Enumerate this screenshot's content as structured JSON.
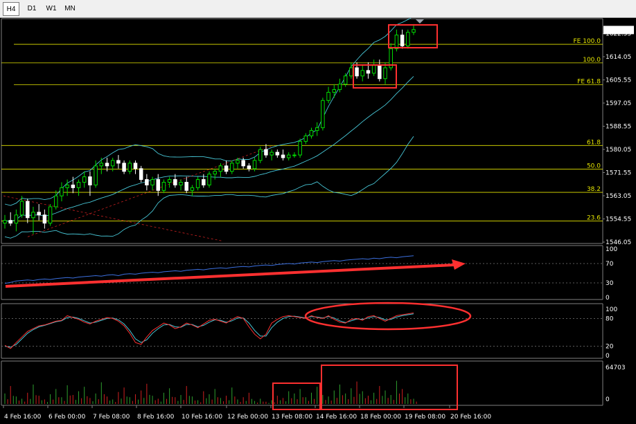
{
  "toolbar": {
    "timeframes": [
      {
        "label": "H4",
        "active": true
      },
      {
        "label": "D1",
        "active": false
      },
      {
        "label": "W1",
        "active": false
      },
      {
        "label": "MN",
        "active": false
      }
    ]
  },
  "chart_data": {
    "type": "candlestick",
    "main": {
      "ylim": [
        1546.05,
        1627.5
      ],
      "y_ticks": [
        1546.05,
        1554.55,
        1563.05,
        1571.55,
        1580.05,
        1588.55,
        1597.05,
        1605.55,
        1614.05,
        1622.55
      ],
      "current_price": 1623.85,
      "levels": [
        {
          "label": "FE 100.0",
          "price": 1618.6,
          "x_from": 20
        },
        {
          "label": "100.0",
          "price": 1611.8,
          "x_from": 0
        },
        {
          "label": "FE 61.8",
          "price": 1603.8,
          "x_from": 20
        },
        {
          "label": "61.8",
          "price": 1581.5,
          "x_from": 0
        },
        {
          "label": "50.0",
          "price": 1572.8,
          "x_from": 0
        },
        {
          "label": "38.2",
          "price": 1564.3,
          "x_from": 0
        },
        {
          "label": "23.6",
          "price": 1553.8,
          "x_from": 0
        }
      ],
      "ohlc": [
        [
          1553,
          1556,
          1551,
          1554
        ],
        [
          1554,
          1557,
          1552,
          1553
        ],
        [
          1553,
          1558,
          1550,
          1556
        ],
        [
          1556,
          1563,
          1555,
          1561
        ],
        [
          1561,
          1562,
          1553,
          1555
        ],
        [
          1555,
          1559,
          1549,
          1557
        ],
        [
          1557,
          1560,
          1554,
          1556
        ],
        [
          1556,
          1558,
          1551,
          1553
        ],
        [
          1553,
          1560,
          1552,
          1559
        ],
        [
          1559,
          1565,
          1558,
          1563
        ],
        [
          1563,
          1568,
          1561,
          1566
        ],
        [
          1566,
          1569,
          1563,
          1567
        ],
        [
          1567,
          1570,
          1564,
          1566
        ],
        [
          1566,
          1569,
          1563,
          1568
        ],
        [
          1568,
          1572,
          1566,
          1570
        ],
        [
          1570,
          1572,
          1563,
          1567
        ],
        [
          1567,
          1576,
          1566,
          1574
        ],
        [
          1574,
          1577,
          1571,
          1575
        ],
        [
          1575,
          1577,
          1572,
          1574
        ],
        [
          1574,
          1577,
          1572,
          1576
        ],
        [
          1576,
          1578,
          1573,
          1575
        ],
        [
          1575,
          1576,
          1571,
          1572
        ],
        [
          1572,
          1576,
          1571,
          1575
        ],
        [
          1575,
          1576,
          1571,
          1573
        ],
        [
          1573,
          1574,
          1568,
          1569
        ],
        [
          1569,
          1571,
          1565,
          1567
        ],
        [
          1567,
          1570,
          1565,
          1569
        ],
        [
          1569,
          1571,
          1563,
          1565
        ],
        [
          1565,
          1569,
          1564,
          1568
        ],
        [
          1568,
          1570,
          1566,
          1569
        ],
        [
          1569,
          1571,
          1566,
          1567
        ],
        [
          1567,
          1569,
          1565,
          1568
        ],
        [
          1568,
          1570,
          1564,
          1565
        ],
        [
          1565,
          1567,
          1563,
          1566
        ],
        [
          1566,
          1570,
          1565,
          1569
        ],
        [
          1569,
          1571,
          1566,
          1567
        ],
        [
          1567,
          1572,
          1566,
          1571
        ],
        [
          1571,
          1573,
          1569,
          1572
        ],
        [
          1572,
          1575,
          1570,
          1574
        ],
        [
          1574,
          1576,
          1571,
          1572
        ],
        [
          1572,
          1576,
          1571,
          1575
        ],
        [
          1575,
          1577,
          1573,
          1576
        ],
        [
          1576,
          1577,
          1573,
          1574
        ],
        [
          1574,
          1575,
          1572,
          1573
        ],
        [
          1573,
          1577,
          1572,
          1576
        ],
        [
          1576,
          1581,
          1575,
          1580
        ],
        [
          1580,
          1582,
          1577,
          1578
        ],
        [
          1578,
          1580,
          1576,
          1579
        ],
        [
          1579,
          1580,
          1577,
          1578
        ],
        [
          1578,
          1580,
          1576,
          1577
        ],
        [
          1577,
          1579,
          1576,
          1578
        ],
        [
          1578,
          1579,
          1577,
          1578
        ],
        [
          1578,
          1584,
          1577,
          1583
        ],
        [
          1583,
          1586,
          1582,
          1585
        ],
        [
          1585,
          1588,
          1584,
          1587
        ],
        [
          1587,
          1590,
          1585,
          1588
        ],
        [
          1588,
          1599,
          1587,
          1598
        ],
        [
          1598,
          1603,
          1597,
          1601
        ],
        [
          1601,
          1604,
          1599,
          1602
        ],
        [
          1602,
          1606,
          1601,
          1604
        ],
        [
          1604,
          1608,
          1603,
          1607
        ],
        [
          1607,
          1612,
          1606,
          1610
        ],
        [
          1610,
          1612,
          1606,
          1607
        ],
        [
          1607,
          1611,
          1605,
          1609
        ],
        [
          1609,
          1612,
          1606,
          1608
        ],
        [
          1608,
          1613,
          1607,
          1611
        ],
        [
          1611,
          1613,
          1605,
          1606
        ],
        [
          1606,
          1612,
          1604,
          1610
        ],
        [
          1610,
          1619,
          1609,
          1617
        ],
        [
          1617,
          1624,
          1616,
          1622
        ],
        [
          1622,
          1624,
          1617,
          1618
        ],
        [
          1618,
          1624,
          1617,
          1623
        ],
        [
          1623,
          1626,
          1622,
          1624
        ]
      ]
    },
    "indicator1": {
      "ylim": [
        0,
        100
      ],
      "y_ticks": [
        0,
        30,
        70,
        100
      ],
      "values": [
        29,
        31,
        34,
        35,
        36,
        35,
        37,
        38,
        37,
        39,
        40,
        41,
        40,
        42,
        43,
        44,
        45,
        44,
        46,
        47,
        45,
        48,
        49,
        48,
        50,
        51,
        52,
        51,
        53,
        54,
        55,
        54,
        56,
        57,
        58,
        57,
        59,
        60,
        61,
        60,
        62,
        63,
        64,
        63,
        65,
        66,
        67,
        66,
        68,
        69,
        70,
        69,
        71,
        72,
        73,
        72,
        74,
        75,
        76,
        75,
        77,
        78,
        79,
        80,
        79,
        81,
        80,
        82,
        83,
        82,
        84,
        85,
        86
      ]
    },
    "indicator2": {
      "ylim": [
        0,
        100
      ],
      "y_ticks": [
        0,
        20,
        80,
        100
      ],
      "main_values": [
        22,
        15,
        28,
        40,
        52,
        58,
        64,
        66,
        70,
        74,
        76,
        86,
        82,
        78,
        72,
        68,
        74,
        78,
        82,
        80,
        74,
        64,
        48,
        28,
        24,
        40,
        54,
        62,
        70,
        66,
        58,
        62,
        70,
        66,
        60,
        68,
        76,
        78,
        74,
        70,
        78,
        84,
        80,
        62,
        46,
        36,
        46,
        70,
        78,
        84,
        86,
        84,
        82,
        80,
        86,
        82,
        80,
        86,
        78,
        72,
        70,
        78,
        80,
        76,
        84,
        86,
        80,
        74,
        80,
        86,
        88,
        90,
        92
      ],
      "signal_values": [
        20,
        18,
        24,
        36,
        48,
        56,
        62,
        65,
        69,
        73,
        75,
        82,
        83,
        80,
        75,
        70,
        72,
        76,
        80,
        81,
        77,
        68,
        54,
        36,
        28,
        34,
        48,
        58,
        66,
        67,
        62,
        61,
        67,
        67,
        62,
        65,
        72,
        77,
        76,
        72,
        75,
        81,
        81,
        70,
        54,
        42,
        42,
        60,
        72,
        80,
        84,
        85,
        83,
        81,
        84,
        83,
        81,
        84,
        81,
        75,
        71,
        75,
        79,
        78,
        81,
        84,
        82,
        77,
        78,
        83,
        86,
        88,
        90
      ]
    },
    "volume": {
      "ymax": 64703,
      "y_ticks": [
        0,
        64703
      ],
      "values": [
        28,
        48,
        20,
        14,
        30,
        52,
        22,
        12,
        26,
        40,
        18,
        50,
        24,
        34,
        46,
        16,
        28,
        58,
        20,
        12,
        32,
        44,
        18,
        26,
        36,
        54,
        22,
        14,
        30,
        42,
        18,
        24,
        48,
        20,
        10,
        34,
        26,
        40,
        16,
        22,
        44,
        12,
        18,
        30,
        8,
        14,
        6,
        10,
        22,
        16,
        34,
        28,
        40,
        18,
        30,
        46,
        24,
        20,
        36,
        52,
        28,
        42,
        60,
        34,
        22,
        30,
        48,
        36,
        24,
        62,
        40,
        28,
        14
      ],
      "colors_up": "#2ea02e",
      "colors_down": "#d02020"
    },
    "x_labels": [
      "4 Feb 16:00",
      "6 Feb 00:00",
      "7 Feb 08:00",
      "8 Feb 16:00",
      "10 Feb 16:00",
      "12 Feb 00:00",
      "13 Feb 08:00",
      "14 Feb 16:00",
      "18 Feb 00:00",
      "19 Feb 08:00",
      "20 Feb 16:00"
    ]
  },
  "colors": {
    "background": "#000000",
    "bull": "#00dd00",
    "bear": "#ffffff",
    "level_line": "#e6e600",
    "bollinger": "#48c8d8",
    "trend_dashed": "#c82020",
    "indicator_line": "#3c70e0",
    "annotation": "#ff3030",
    "stoch_main": "#ff3030",
    "stoch_signal": "#48c8d8"
  }
}
